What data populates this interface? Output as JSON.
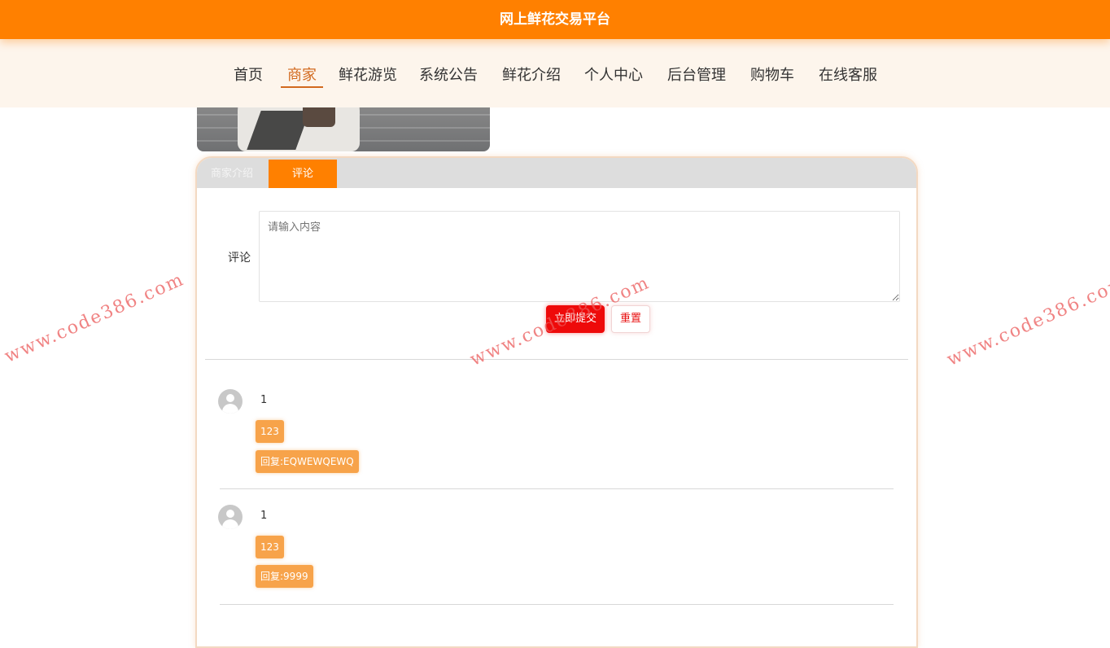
{
  "header": {
    "title": "网上鲜花交易平台"
  },
  "nav": {
    "items": [
      {
        "label": "首页"
      },
      {
        "label": "商家"
      },
      {
        "label": "鲜花游览"
      },
      {
        "label": "系统公告"
      },
      {
        "label": "鲜花介绍"
      },
      {
        "label": "个人中心"
      },
      {
        "label": "后台管理"
      },
      {
        "label": "购物车"
      },
      {
        "label": "在线客服"
      }
    ],
    "active_label": "商家"
  },
  "tabs": [
    {
      "label": "商家介绍",
      "active": false
    },
    {
      "label": "评论",
      "active": true
    }
  ],
  "form": {
    "label": "评论",
    "placeholder": "请输入内容",
    "value": "",
    "submit_label": "立即提交",
    "reset_label": "重置"
  },
  "comments": [
    {
      "user": "1",
      "content": "123",
      "reply": "回复:EQWEWQEWQ"
    },
    {
      "user": "1",
      "content": "123",
      "reply": "回复:9999"
    }
  ],
  "watermark": "www.code386.com",
  "colors": {
    "accent": "#ff8000",
    "nav_active": "#d2691e",
    "submit": "#ee0a0a",
    "pill": "#f7a34a"
  }
}
